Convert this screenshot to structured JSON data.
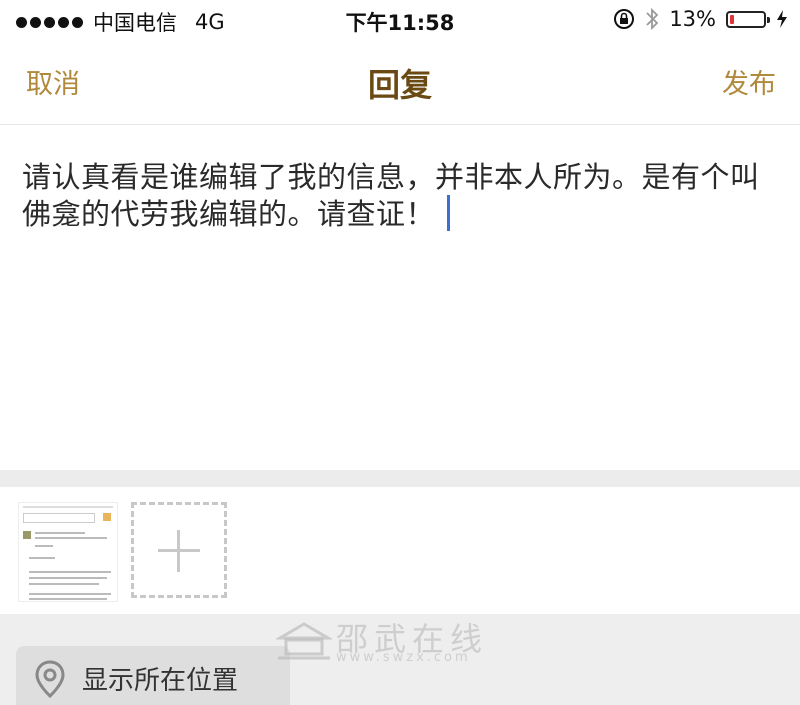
{
  "status_bar": {
    "carrier": "中国电信",
    "network": "4G",
    "time": "下午11:58",
    "battery_percent": "13%",
    "battery_level": 0.13,
    "battery_color": "#e33333"
  },
  "nav": {
    "cancel_label": "取消",
    "title": "回复",
    "publish_label": "发布",
    "accent_color": "#b08a3c"
  },
  "compose": {
    "text": "请认真看是谁编辑了我的信息，并非本人所为。是有个叫佛龛的代劳我编辑的。请查证！"
  },
  "attachments": {
    "items": [
      {
        "type": "image",
        "icon": "screenshot-thumbnail"
      }
    ],
    "add_icon": "plus-icon"
  },
  "location": {
    "label": "显示所在位置",
    "icon": "location-pin-icon"
  },
  "watermark": {
    "text": "邵武在线",
    "url": "www.swzx.com"
  }
}
